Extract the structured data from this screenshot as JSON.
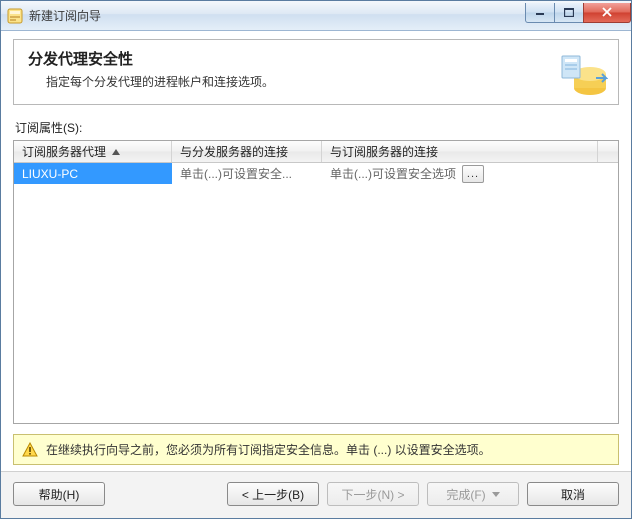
{
  "window": {
    "title": "新建订阅向导"
  },
  "header": {
    "title": "分发代理安全性",
    "description": "指定每个分发代理的进程帐户和连接选项。"
  },
  "table": {
    "label": "订阅属性(S):",
    "columns": {
      "col1": "订阅服务器代理",
      "col2": "与分发服务器的连接",
      "col3": "与订阅服务器的连接"
    },
    "row": {
      "agent": "LIUXU-PC",
      "dist": "单击(...)可设置安全...",
      "sub": "单击(...)可设置安全选项",
      "ellipsis": "..."
    }
  },
  "warning": {
    "text": "在继续执行向导之前，您必须为所有订阅指定安全信息。单击 (...) 以设置安全选项。"
  },
  "footer": {
    "help": "帮助(H)",
    "back": "< 上一步(B)",
    "next": "下一步(N) >",
    "finish": "完成(F)",
    "cancel": "取消"
  }
}
